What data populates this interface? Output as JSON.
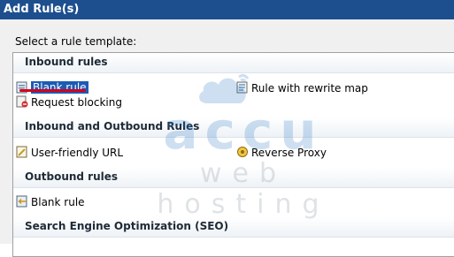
{
  "window": {
    "title": "Add Rule(s)"
  },
  "dialog": {
    "prompt": "Select a rule template:"
  },
  "groups": [
    {
      "header": "Inbound rules",
      "items": [
        {
          "label": "Blank rule",
          "icon": "blank-rule-icon",
          "selected": true
        },
        {
          "label": "Rule with rewrite map",
          "icon": "rewrite-map-icon"
        },
        {
          "label": "Request blocking",
          "icon": "request-blocking-icon"
        }
      ]
    },
    {
      "header": "Inbound and Outbound Rules",
      "items": [
        {
          "label": "User-friendly URL",
          "icon": "user-friendly-url-icon"
        },
        {
          "label": "Reverse Proxy",
          "icon": "reverse-proxy-icon"
        }
      ]
    },
    {
      "header": "Outbound rules",
      "items": [
        {
          "label": "Blank rule",
          "icon": "blank-rule-icon"
        }
      ]
    },
    {
      "header": "Search Engine Optimization (SEO)",
      "items": []
    }
  ],
  "watermark": {
    "word": "accu",
    "sub": "web hosting"
  },
  "colors": {
    "titlebar": "#1d4f8f",
    "selection": "#1c5bb5",
    "highlight_underline": "#d4001a",
    "watermark": "#2a79c7"
  }
}
